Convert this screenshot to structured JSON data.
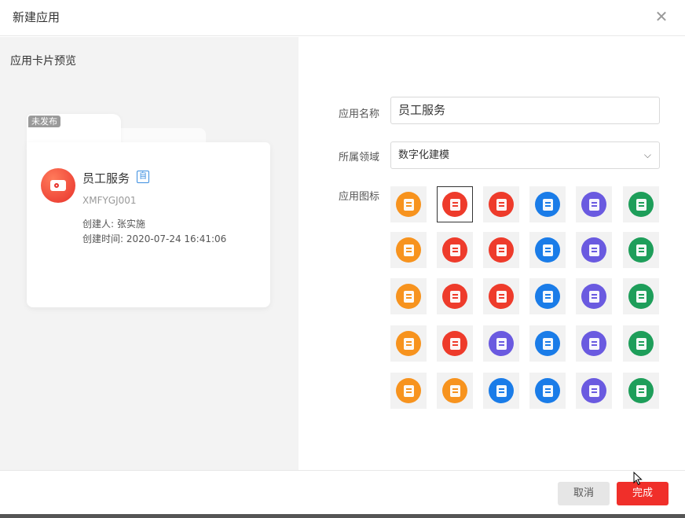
{
  "dialog": {
    "title": "新建应用",
    "close_icon": "close-icon"
  },
  "preview": {
    "label": "应用卡片预览",
    "badge": "未发布",
    "app_name": "员工服务",
    "name_tag": "自",
    "app_code": "XMFYGJ001",
    "creator": "创建人: 张实施",
    "created_time": "创建时间: 2020-07-24 16:41:06"
  },
  "form": {
    "name_label": "应用名称",
    "name_value": "员工服务",
    "domain_label": "所属领域",
    "domain_value": "数字化建模",
    "icon_label": "应用图标"
  },
  "icons": [
    {
      "name": "briefcase-icon",
      "color": "#f7931e",
      "selected": false
    },
    {
      "name": "service-icon",
      "color": "#ee3b2b",
      "selected": true
    },
    {
      "name": "clipboard-icon",
      "color": "#ee3b2b",
      "selected": false
    },
    {
      "name": "doc-settings-icon",
      "color": "#1a7ce8",
      "selected": false
    },
    {
      "name": "task-icon",
      "color": "#6a5ae0",
      "selected": false
    },
    {
      "name": "doc-add-icon",
      "color": "#1e9e5a",
      "selected": false
    },
    {
      "name": "calendar-icon",
      "color": "#f7931e",
      "selected": false
    },
    {
      "name": "form-icon",
      "color": "#ee3b2b",
      "selected": false
    },
    {
      "name": "report-icon",
      "color": "#ee3b2b",
      "selected": false
    },
    {
      "name": "notes-icon",
      "color": "#1a7ce8",
      "selected": false
    },
    {
      "name": "case-icon",
      "color": "#6a5ae0",
      "selected": false
    },
    {
      "name": "book-icon",
      "color": "#1e9e5a",
      "selected": false
    },
    {
      "name": "checklist-icon",
      "color": "#f7931e",
      "selected": false
    },
    {
      "name": "gift-icon",
      "color": "#ee3b2b",
      "selected": false
    },
    {
      "name": "grid-icon",
      "color": "#ee3b2b",
      "selected": false
    },
    {
      "name": "list-icon",
      "color": "#1a7ce8",
      "selected": false
    },
    {
      "name": "archive-icon",
      "color": "#6a5ae0",
      "selected": false
    },
    {
      "name": "monitor-icon",
      "color": "#1e9e5a",
      "selected": false
    },
    {
      "name": "document-icon",
      "color": "#f7931e",
      "selected": false
    },
    {
      "name": "doc-edit-icon",
      "color": "#ee3b2b",
      "selected": false
    },
    {
      "name": "inbox-icon",
      "color": "#6a5ae0",
      "selected": false
    },
    {
      "name": "doc-check-icon",
      "color": "#1a7ce8",
      "selected": false
    },
    {
      "name": "doc-gear-icon",
      "color": "#6a5ae0",
      "selected": false
    },
    {
      "name": "note-icon",
      "color": "#1e9e5a",
      "selected": false
    },
    {
      "name": "search-chart-icon",
      "color": "#f7931e",
      "selected": false
    },
    {
      "name": "bar-chart-icon",
      "color": "#f7931e",
      "selected": false
    },
    {
      "name": "text-doc-icon",
      "color": "#1a7ce8",
      "selected": false
    },
    {
      "name": "doc-search-icon",
      "color": "#1a7ce8",
      "selected": false
    },
    {
      "name": "wave-icon",
      "color": "#6a5ae0",
      "selected": false
    },
    {
      "name": "sheet-icon",
      "color": "#1e9e5a",
      "selected": false
    }
  ],
  "footer": {
    "cancel_label": "取消",
    "done_label": "完成"
  }
}
